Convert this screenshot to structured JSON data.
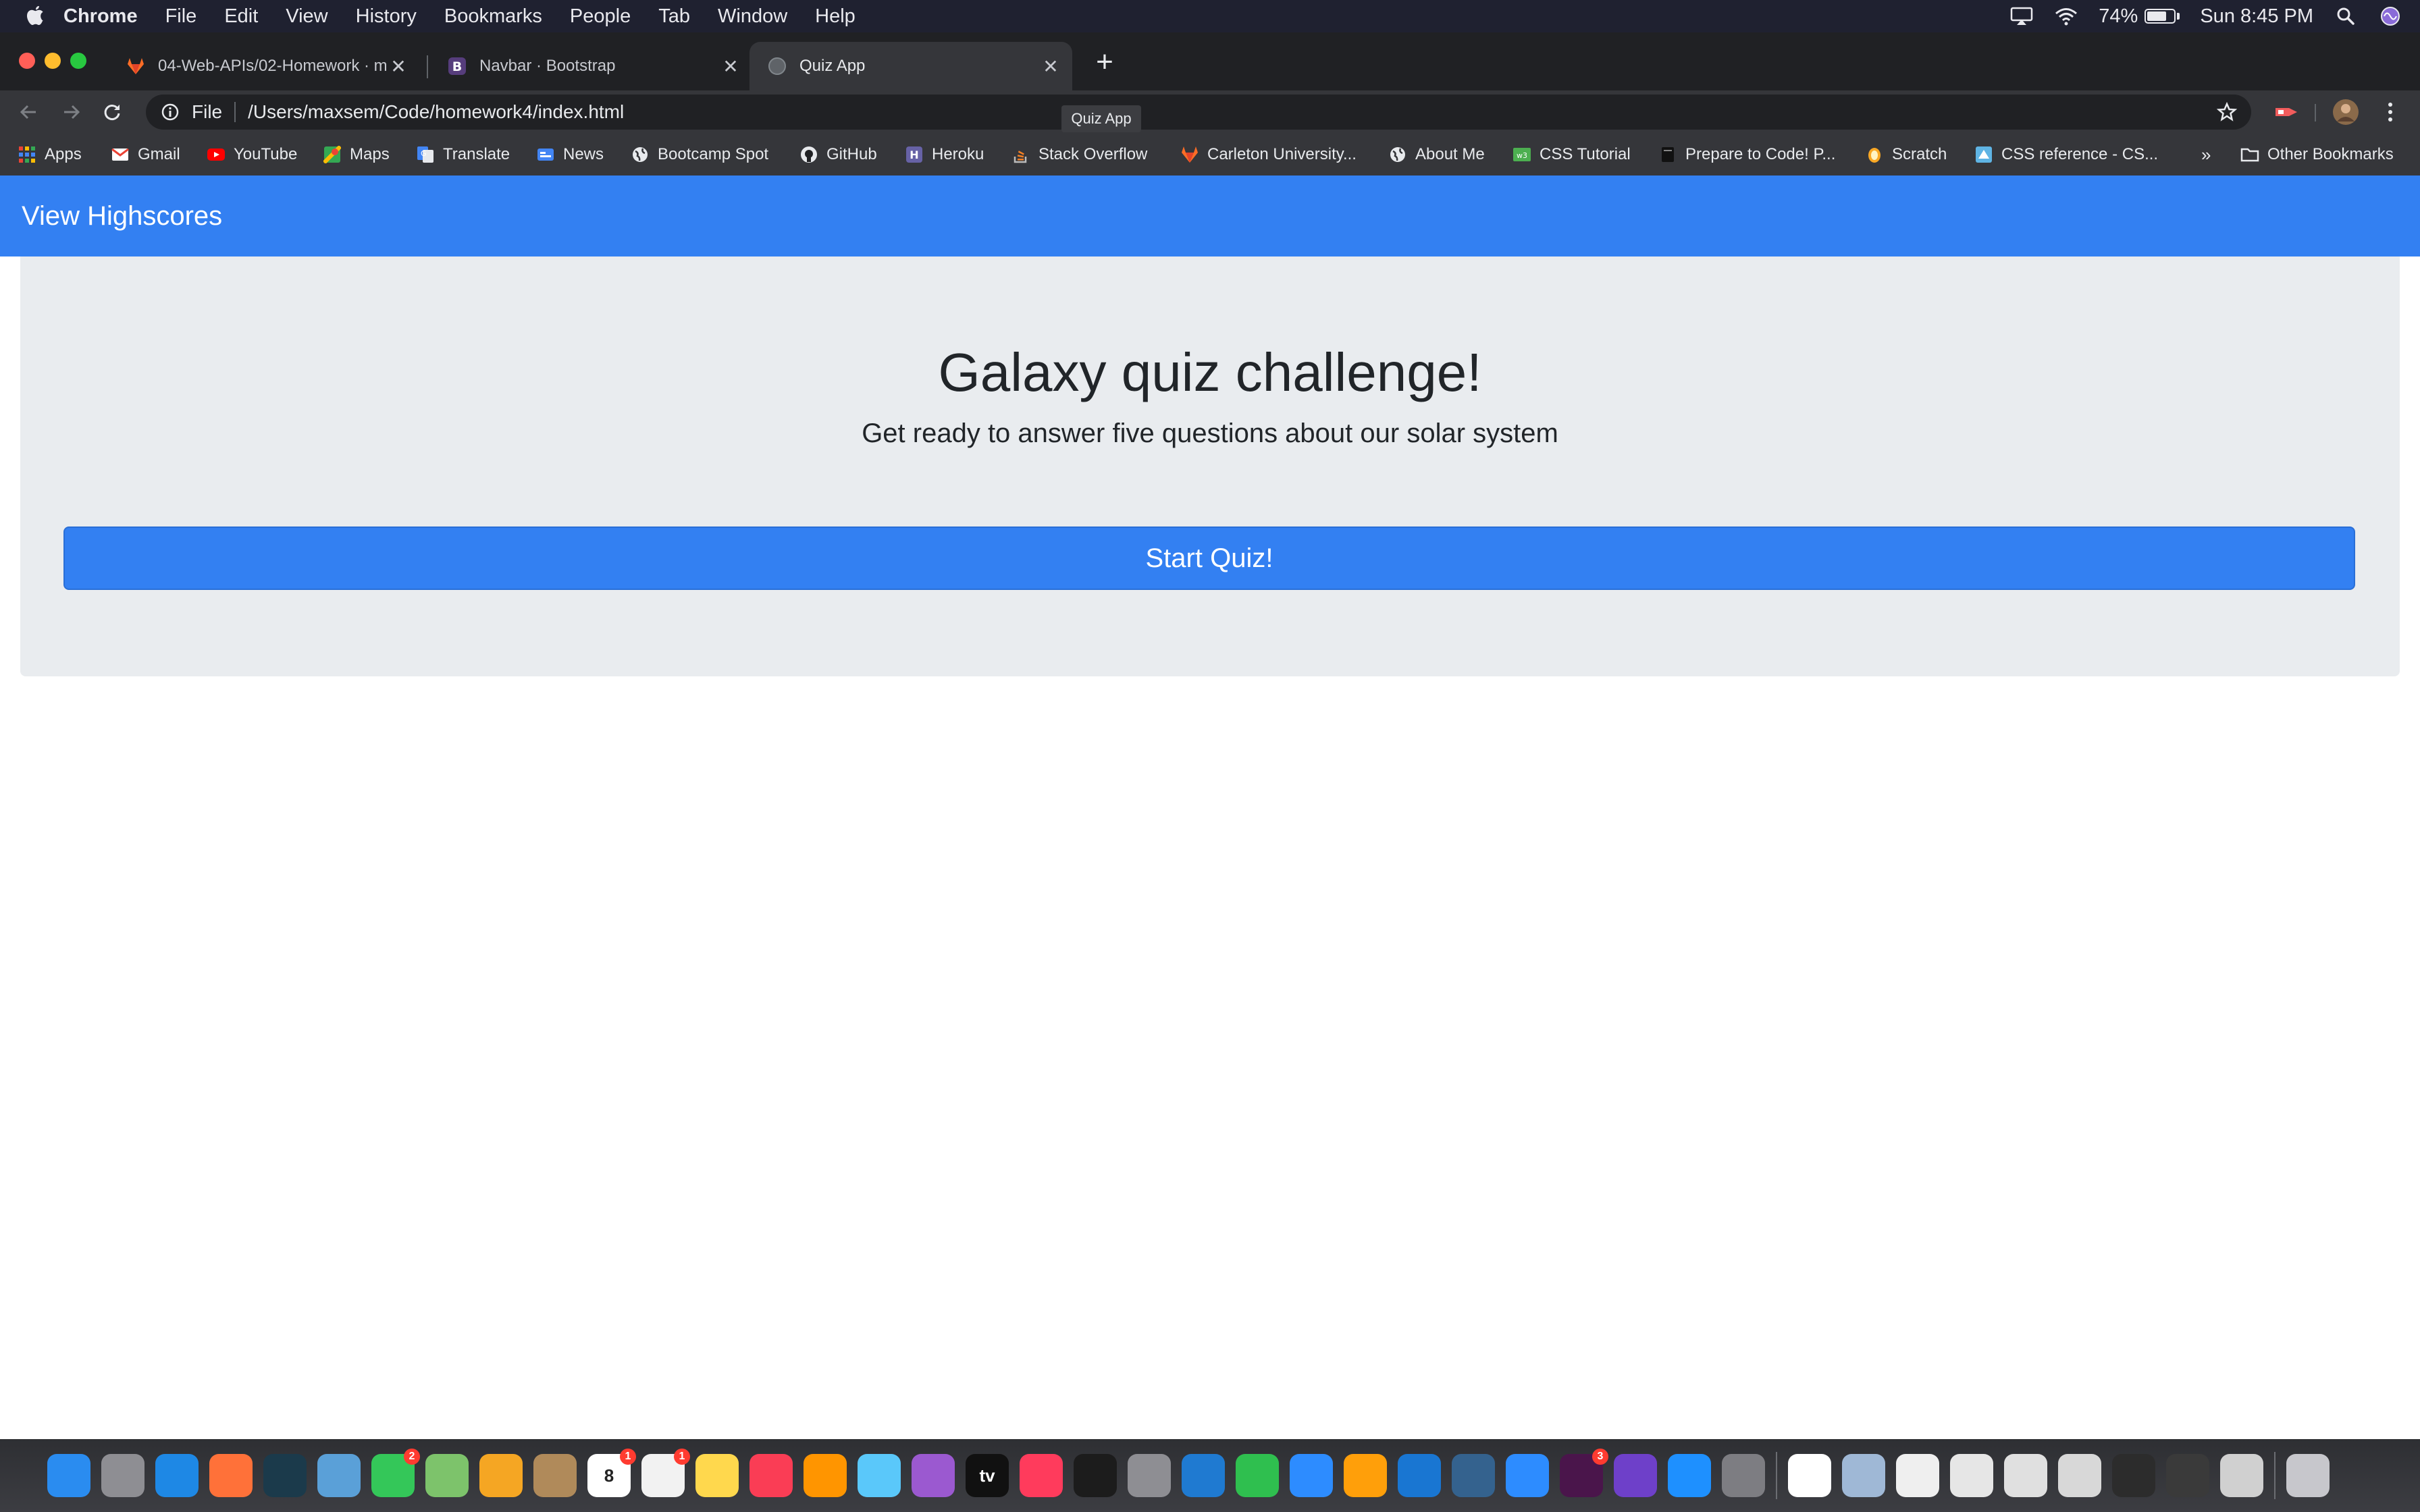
{
  "menubar": {
    "app_name": "Chrome",
    "menus": [
      "File",
      "Edit",
      "View",
      "History",
      "Bookmarks",
      "People",
      "Tab",
      "Window",
      "Help"
    ],
    "battery_percent": "74%",
    "battery_level": 0.74,
    "clock": "Sun 8:45 PM",
    "icons": [
      "apple-icon",
      "airplay-icon",
      "wifi-icon",
      "battery-icon",
      "spotlight-icon",
      "siri-icon"
    ]
  },
  "tabs": [
    {
      "title": "04-Web-APIs/02-Homework · m",
      "icon": "gitlab-icon",
      "active": false
    },
    {
      "title": "Navbar · Bootstrap",
      "icon": "bootstrap-icon",
      "active": false
    },
    {
      "title": "Quiz App",
      "icon": "globe-icon",
      "active": true
    }
  ],
  "toolbar": {
    "scheme_label": "File",
    "url": "/Users/maxsem/Code/homework4/index.html",
    "tooltip": "Quiz App"
  },
  "bookmarks": {
    "items": [
      {
        "label": "Apps",
        "icon": "apps-grid-icon"
      },
      {
        "label": "Gmail",
        "icon": "gmail-icon"
      },
      {
        "label": "YouTube",
        "icon": "youtube-icon"
      },
      {
        "label": "Maps",
        "icon": "maps-icon"
      },
      {
        "label": "Translate",
        "icon": "translate-icon"
      },
      {
        "label": "News",
        "icon": "news-icon"
      },
      {
        "label": "Bootcamp Spot",
        "icon": "globe-icon"
      },
      {
        "label": "GitHub",
        "icon": "github-icon"
      },
      {
        "label": "Heroku",
        "icon": "heroku-icon"
      },
      {
        "label": "Stack Overflow",
        "icon": "stackoverflow-icon"
      },
      {
        "label": "Carleton University...",
        "icon": "gitlab-icon"
      },
      {
        "label": "About Me",
        "icon": "globe-icon"
      },
      {
        "label": "CSS Tutorial",
        "icon": "w3schools-icon"
      },
      {
        "label": "Prepare to Code! P...",
        "icon": "book-icon"
      },
      {
        "label": "Scratch",
        "icon": "scratch-icon"
      },
      {
        "label": "CSS reference - CS...",
        "icon": "css-reference-icon"
      }
    ],
    "overflow": "»",
    "other": "Other Bookmarks"
  },
  "page": {
    "navbar_brand": "View Highscores",
    "title": "Galaxy quiz challenge!",
    "subtitle": "Get ready to answer five questions about our solar system",
    "start_button": "Start Quiz!",
    "colors": {
      "primary": "#3380f2",
      "jumbotron": "#e9ecef",
      "text": "#212529"
    }
  },
  "dock": {
    "items": [
      {
        "name": "finder",
        "color": "#2a8cf0"
      },
      {
        "name": "launchpad",
        "color": "#8e8e93"
      },
      {
        "name": "safari",
        "color": "#1e88e5"
      },
      {
        "name": "firefox",
        "color": "#ff7139"
      },
      {
        "name": "league-of-legends",
        "color": "#1b3a4b"
      },
      {
        "name": "preview",
        "color": "#5aa0d8"
      },
      {
        "name": "facetime",
        "color": "#34c759",
        "badge": "2"
      },
      {
        "name": "maps",
        "color": "#7dc36b"
      },
      {
        "name": "photos",
        "color": "#f5a623"
      },
      {
        "name": "contacts",
        "color": "#b08a5a"
      },
      {
        "name": "calendar",
        "color": "#ffffff",
        "badge": "1",
        "text": "8"
      },
      {
        "name": "reminders",
        "color": "#f2f2f2",
        "badge": "1"
      },
      {
        "name": "notes",
        "color": "#ffd84d"
      },
      {
        "name": "music",
        "color": "#fa3d55"
      },
      {
        "name": "books",
        "color": "#ff9500"
      },
      {
        "name": "kindle",
        "color": "#5ac8fa"
      },
      {
        "name": "podcasts",
        "color": "#9b59d0"
      },
      {
        "name": "tv",
        "color": "#111111",
        "text": "tv"
      },
      {
        "name": "news",
        "color": "#ff3b5c"
      },
      {
        "name": "terminal",
        "color": "#1c1c1c"
      },
      {
        "name": "archive",
        "color": "#8e8e93"
      },
      {
        "name": "vscode",
        "color": "#1f7ad1"
      },
      {
        "name": "numbers",
        "color": "#2fbf4f"
      },
      {
        "name": "keynote",
        "color": "#2d8cff"
      },
      {
        "name": "pages",
        "color": "#ff9f0a"
      },
      {
        "name": "xcode",
        "color": "#1976d2"
      },
      {
        "name": "mysql-workbench",
        "color": "#34628e"
      },
      {
        "name": "zoom",
        "color": "#2d8cff"
      },
      {
        "name": "slack",
        "color": "#4a154b",
        "badge": "3"
      },
      {
        "name": "github-desktop",
        "color": "#6e40c9"
      },
      {
        "name": "app-store",
        "color": "#1e90ff"
      },
      {
        "name": "system-preferences",
        "color": "#7d7d82"
      },
      {
        "name": "chrome",
        "color": "#ffffff"
      },
      {
        "name": "preview-docs",
        "color": "#9fb8d6"
      },
      {
        "name": "textedit",
        "color": "#efefef"
      },
      {
        "name": "doc-stack-1",
        "color": "#e6e6e6"
      },
      {
        "name": "doc-stack-2",
        "color": "#e0e0e0"
      },
      {
        "name": "doc-stack-3",
        "color": "#d8d8d8"
      },
      {
        "name": "doc-stack-4",
        "color": "#2c2c2c"
      },
      {
        "name": "doc-stack-5",
        "color": "#3a3a3a"
      },
      {
        "name": "doc-stack-6",
        "color": "#d0d0d0"
      },
      {
        "name": "trash",
        "color": "#c7c7cc"
      }
    ]
  }
}
